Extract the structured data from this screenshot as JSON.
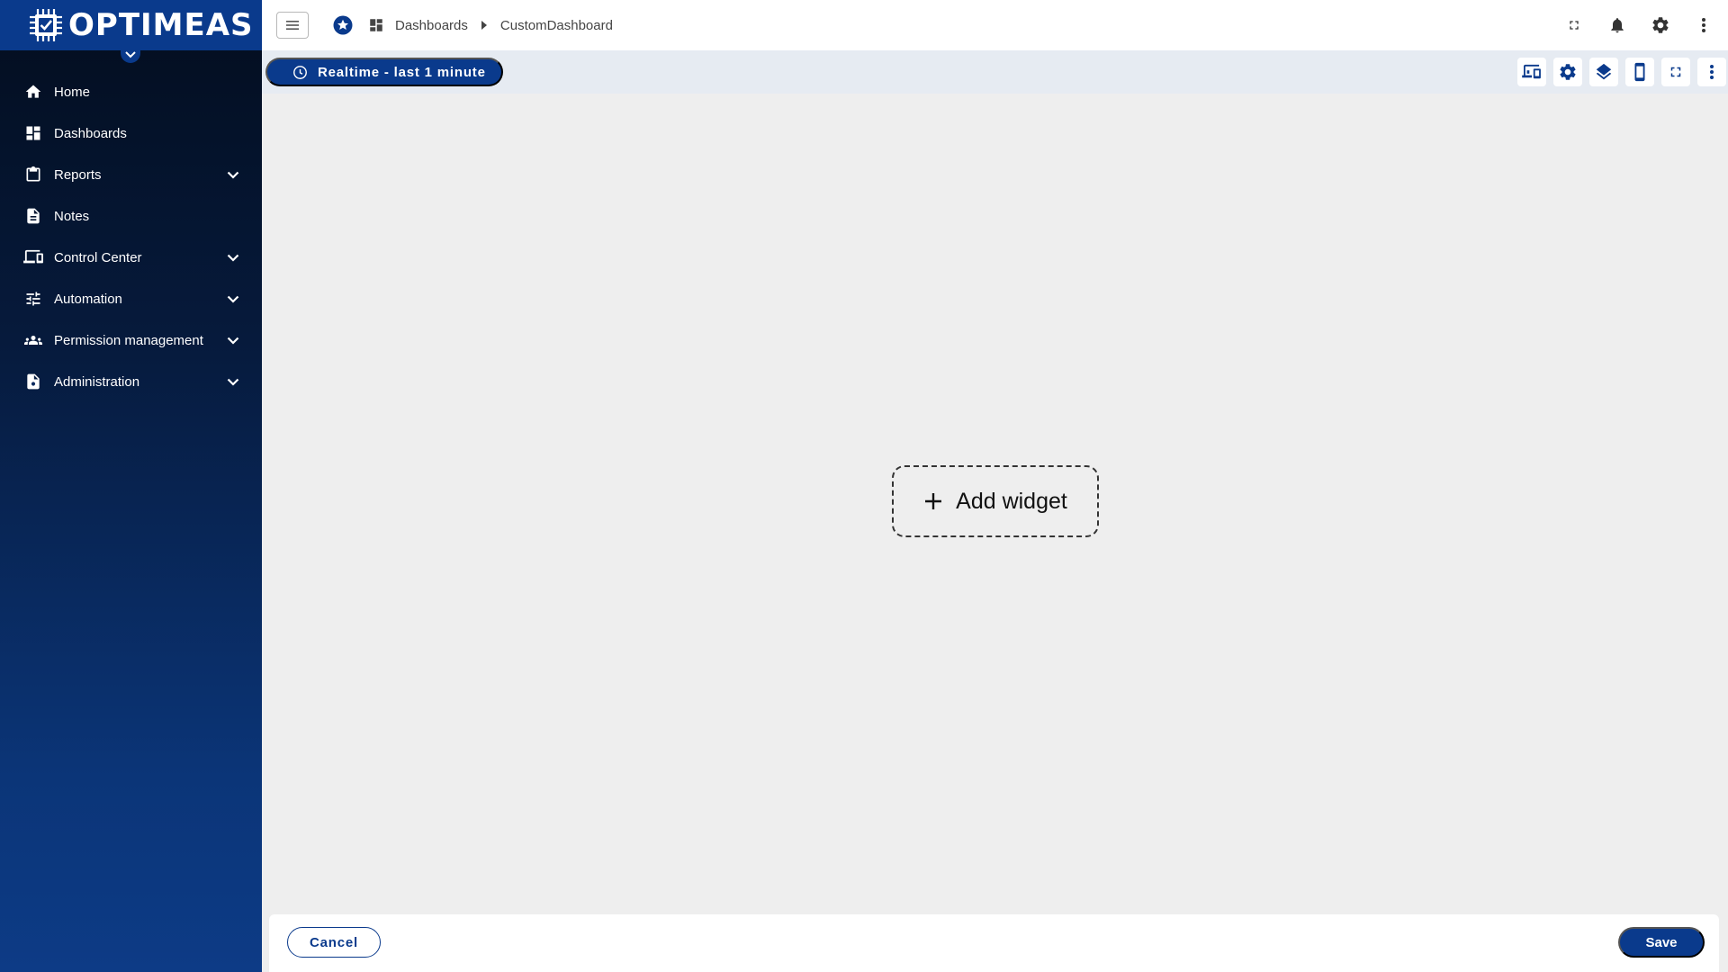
{
  "brand": {
    "name": "OPTIMEAS",
    "logo_icon": "chip-check-icon",
    "color": "#0a3a8c"
  },
  "sidebar": {
    "items": [
      {
        "label": "Home",
        "icon": "home-icon",
        "expandable": false
      },
      {
        "label": "Dashboards",
        "icon": "dashboard-icon",
        "expandable": false
      },
      {
        "label": "Reports",
        "icon": "clipboard-icon",
        "expandable": true
      },
      {
        "label": "Notes",
        "icon": "document-icon",
        "expandable": false
      },
      {
        "label": "Control Center",
        "icon": "devices-icon",
        "expandable": true
      },
      {
        "label": "Automation",
        "icon": "sliders-icon",
        "expandable": true
      },
      {
        "label": "Permission management",
        "icon": "group-icon",
        "expandable": true
      },
      {
        "label": "Administration",
        "icon": "admin-file-icon",
        "expandable": true
      }
    ]
  },
  "topbar": {
    "breadcrumbs": [
      "Dashboards",
      "CustomDashboard"
    ],
    "icons": [
      "fullscreen-icon",
      "bell-icon",
      "gear-icon",
      "more-vert-icon"
    ]
  },
  "toolbar": {
    "time_range": "Realtime - last 1 minute",
    "icons": [
      "device-layout-icon",
      "settings-icon",
      "layers-icon",
      "mobile-icon",
      "fullscreen-icon",
      "more-vert-icon"
    ]
  },
  "canvas": {
    "add_widget_label": "Add widget"
  },
  "footer": {
    "cancel_label": "Cancel",
    "save_label": "Save"
  }
}
